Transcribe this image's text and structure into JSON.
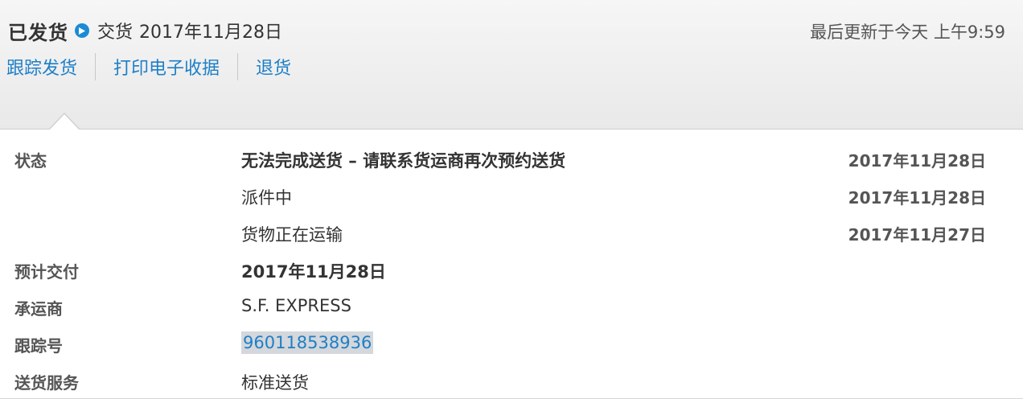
{
  "header": {
    "status_title": "已发货",
    "delivery_label": "交货",
    "delivery_date": "2017年11月28日",
    "last_updated": "最后更新于今天 上午9:59",
    "links": [
      "跟踪发货",
      "打印电子收据",
      "退货"
    ]
  },
  "details": {
    "status_label": "状态",
    "events": [
      {
        "text": "无法完成送货 – 请联系货运商再次预约送货",
        "date": "2017年11月28日"
      },
      {
        "text": "派件中",
        "date": "2017年11月28日"
      },
      {
        "text": "货物正在运输",
        "date": "2017年11月27日"
      }
    ],
    "eta_label": "预计交付",
    "eta_value": "2017年11月28日",
    "carrier_label": "承运商",
    "carrier_value": "S.F. EXPRESS",
    "tracking_label": "跟踪号",
    "tracking_value": "960118538936",
    "service_label": "送货服务",
    "service_value": "标准送货"
  },
  "colors": {
    "link": "#1e7fc7",
    "accent_icon": "#1a8bd6",
    "header_bg": "#eeeeee",
    "selection": "#d4d7db"
  },
  "icons": {
    "status": "play-icon"
  }
}
